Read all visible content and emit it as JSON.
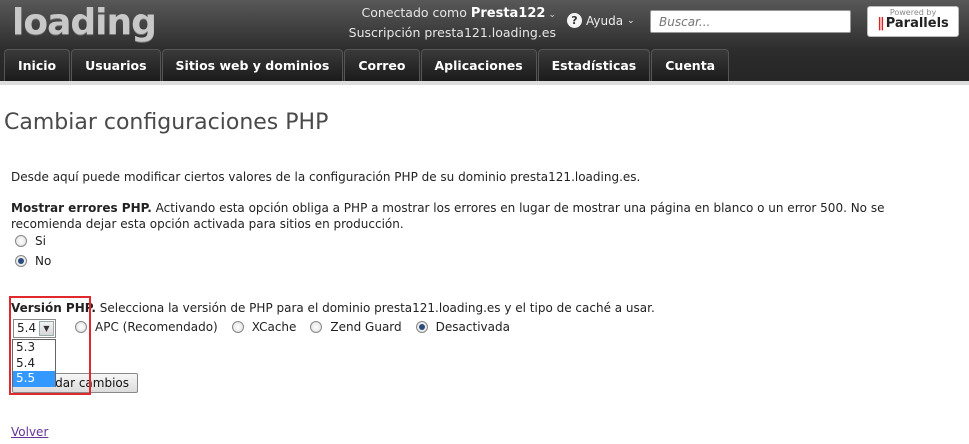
{
  "header": {
    "logo": "loading",
    "connected_label": "Conectado como",
    "username": "Presta122",
    "subscription_label": "Suscripción",
    "subscription": "presta121.loading.es",
    "help_label": "Ayuda",
    "search_placeholder": "Buscar...",
    "powered_by": "Powered by",
    "powered_brand": "Parallels"
  },
  "nav": {
    "items": [
      {
        "label": "Inicio"
      },
      {
        "label": "Usuarios"
      },
      {
        "label": "Sitios web y dominios"
      },
      {
        "label": "Correo"
      },
      {
        "label": "Aplicaciones"
      },
      {
        "label": "Estadísticas"
      },
      {
        "label": "Cuenta"
      }
    ]
  },
  "main": {
    "title": "Cambiar configuraciones PHP",
    "intro": "Desde aquí puede modificar ciertos valores de la configuración PHP de su dominio presta121.loading.es.",
    "errors_heading": "Mostrar errores PHP.",
    "errors_text": "Activando esta opción obliga a PHP a mostrar los errores en lugar de mostrar una página en blanco o un error 500. No se recomienda dejar esta opción activada para sitios en producción.",
    "errors_options": [
      {
        "label": "Si",
        "checked": false
      },
      {
        "label": "No",
        "checked": true
      }
    ],
    "php_heading": "Versión PHP.",
    "php_text": "Selecciona la versión de PHP para el dominio presta121.loading.es y el tipo de caché a usar.",
    "php_selected": "5.4",
    "php_options": [
      "5.3",
      "5.4",
      "5.5"
    ],
    "php_highlighted": "5.5",
    "cache_options": [
      {
        "label": "APC (Recomendado)",
        "checked": false
      },
      {
        "label": "XCache",
        "checked": false
      },
      {
        "label": "Zend Guard",
        "checked": false
      },
      {
        "label": "Desactivada",
        "checked": true
      }
    ],
    "save_button": "Guardar cambios",
    "save_visible": "dar cambios",
    "back_link": "Volver"
  },
  "colors": {
    "highlight_box": "#e0282e",
    "dropdown_selected": "#3399ff",
    "link": "#663399"
  }
}
